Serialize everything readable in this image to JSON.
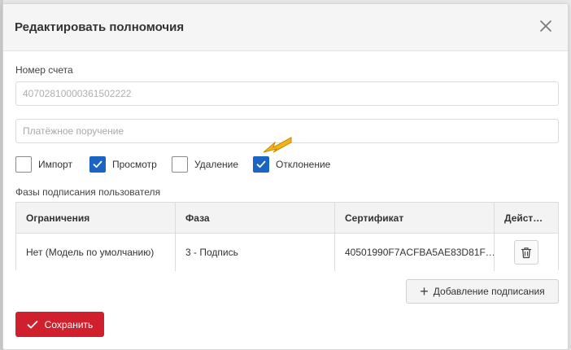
{
  "modal": {
    "title": "Редактировать полномочия"
  },
  "form": {
    "account_label": "Номер счета",
    "account_value": "40702810000361502222",
    "payment_placeholder": "Платёжное поручение"
  },
  "permissions": [
    {
      "label": "Импорт",
      "checked": false
    },
    {
      "label": "Просмотр",
      "checked": true
    },
    {
      "label": "Удаление",
      "checked": false
    },
    {
      "label": "Отклонение",
      "checked": true
    }
  ],
  "phases": {
    "title": "Фазы подписания пользователя",
    "columns": [
      "Ограничения",
      "Фаза",
      "Сертификат",
      "Дейст…"
    ],
    "rows": [
      [
        "Нет (Модель по умолчанию)",
        "3 - Подпись",
        "40501990F7ACFBA5AE83D81F…"
      ]
    ]
  },
  "buttons": {
    "add_sign": "Добавление подписания",
    "save": "Сохранить"
  },
  "colors": {
    "accent": "#1c64c4",
    "primary_button": "#d0202e",
    "arrow": "#f2b21b"
  },
  "icons": {
    "close": "close-icon",
    "trash": "trash-icon",
    "plus": "plus-icon",
    "check": "check-icon",
    "arrow": "arrow-icon"
  }
}
